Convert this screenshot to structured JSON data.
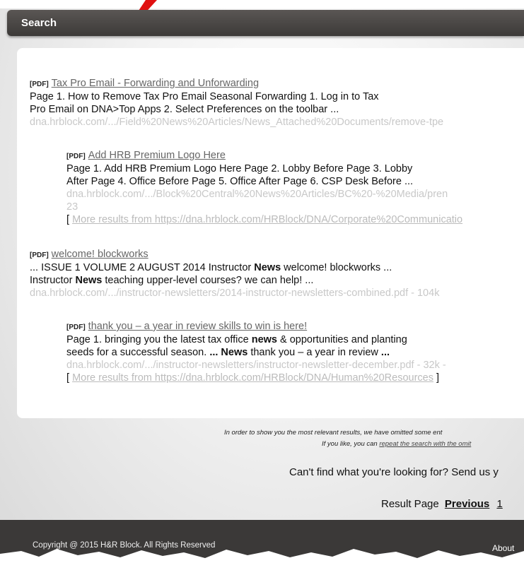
{
  "header": {
    "title": "Search"
  },
  "results": [
    {
      "tag": "[PDF]",
      "title": "Tax Pro Email - Forwarding and Unforwarding",
      "snippet_lines": [
        "Page 1. How to Remove Tax Pro Email Seasonal Forwarding 1. Log in to Tax",
        "Pro Email on DNA>Top Apps 2. Select Preferences on the toolbar ..."
      ],
      "url": "dna.hrblock.com/.../Field%20News%20Articles/News_Attached%20Documents/remove-tpe"
    },
    {
      "tag": "[PDF]",
      "title": "Add HRB Premium Logo Here",
      "snippet_lines": [
        "Page 1. Add HRB Premium Logo Here Page 2. Lobby Before Page 3. Lobby",
        "After Page 4. Office Before Page 5. Office After Page 6. CSP Desk Before ..."
      ],
      "url_lines": [
        "dna.hrblock.com/.../Block%20Central%20News%20Articles/BC%20-%20Media/pren",
        "23"
      ],
      "more_link": "More results from https://dna.hrblock.com/HRBlock/DNA/Corporate%20Communicatio"
    },
    {
      "tag": "[PDF]",
      "title": "welcome! blockworks",
      "snippet_lines": [
        "... ISSUE 1 VOLUME 2 AUGUST 2014 Instructor News welcome! blockworks ...",
        "Instructor News teaching upper-level courses? we can help! ..."
      ],
      "url": "dna.hrblock.com/.../instructor-newsletters/2014-instructor-newsletters-combined.pdf - 104k"
    },
    {
      "tag": "[PDF]",
      "title": "thank you – a year in review skills to win is here!",
      "snippet_lines": [
        "Page 1. bringing you the latest tax office news & opportunities and planting",
        "seeds for a successful season. ... News thank you – a year in review ..."
      ],
      "url": "dna.hrblock.com/.../instructor-newsletters/instructor-newsletter-december.pdf - 32k -",
      "more_link": "More results from https://dna.hrblock.com/HRBlock/DNA/Human%20Resources"
    }
  ],
  "more_prefix": "[",
  "more_suffix": "]",
  "omitted_note": {
    "line1": "In order to show you the most relevant results, we have omitted some ent",
    "line2_prefix": "If you like, you can",
    "line2_link": "repeat the search with the omit"
  },
  "cant_find": "Can't find what you're looking for? Send us y",
  "pager": {
    "label": "Result Page",
    "previous": "Previous",
    "page": "1"
  },
  "footer": {
    "copyright": "Copyright @ 2015 H&R Block. All Rights Reserved",
    "about": "About"
  },
  "colors": {
    "header_bg": "#3c3a38",
    "footer_bg": "#3b3938",
    "link_grey": "#666666",
    "url_grey": "#c8c8c8",
    "arrow": "#e01010"
  }
}
